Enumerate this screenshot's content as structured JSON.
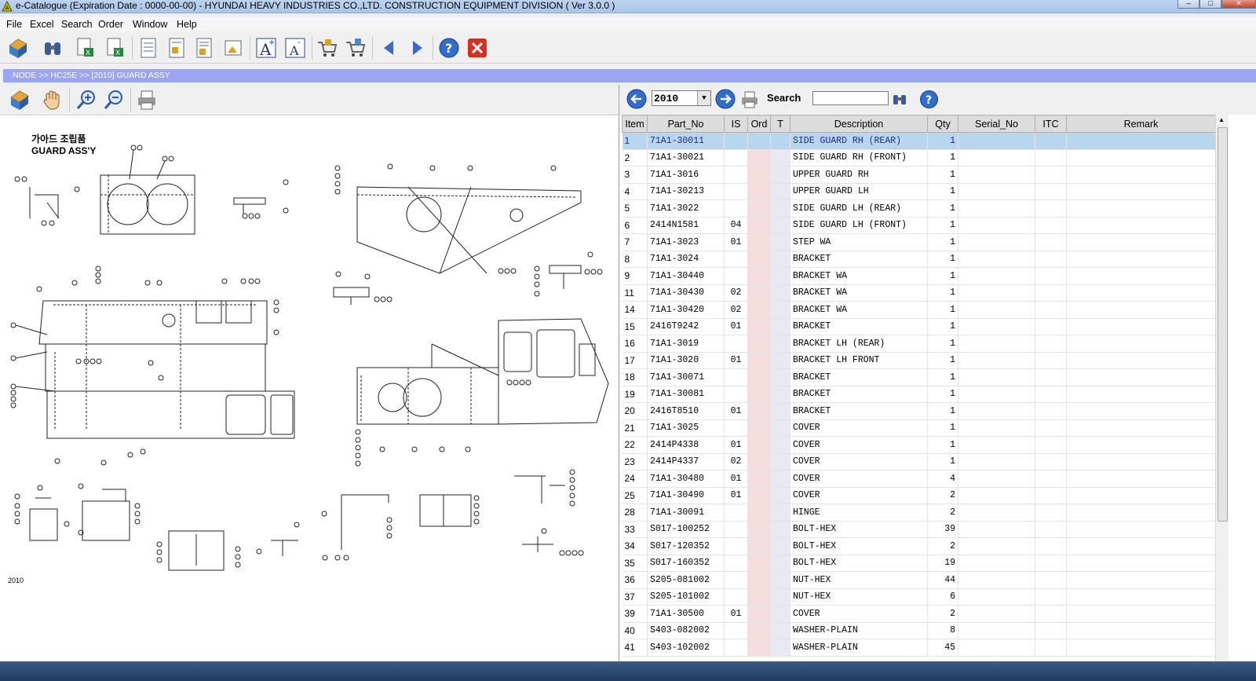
{
  "window": {
    "title": "e-Catalogue (Expiration Date : 0000-00-00)  -  HYUNDAI HEAVY INDUSTRIES CO.,LTD. CONSTRUCTION EQUIPMENT DIVISION ( Ver 3.0.0 )"
  },
  "menu": [
    "File",
    "Excel",
    "Search",
    "Order",
    "Window",
    "Help"
  ],
  "breadcrumb": "NODE >> HC25E >> [2010] GUARD ASSY",
  "drawing": {
    "title_kr": "가아드 조립품",
    "title_en": "GUARD ASS'Y",
    "page_ref": "2010"
  },
  "right_toolbar": {
    "year": "2010",
    "search_label": "Search",
    "search_value": ""
  },
  "table": {
    "columns": [
      "Item",
      "Part_No",
      "IS",
      "Ord",
      "T",
      "Description",
      "Qty",
      "Serial_No",
      "ITC",
      "Remark"
    ],
    "rows": [
      {
        "item": "1",
        "part": "71A1-30011",
        "is": "",
        "desc": "SIDE GUARD RH (REAR)",
        "qty": "1"
      },
      {
        "item": "2",
        "part": "71A1-30021",
        "is": "",
        "desc": "SIDE GUARD RH (FRONT)",
        "qty": "1"
      },
      {
        "item": "3",
        "part": "71A1-3016",
        "is": "",
        "desc": "UPPER GUARD RH",
        "qty": "1"
      },
      {
        "item": "4",
        "part": "71A1-30213",
        "is": "",
        "desc": "UPPER GUARD LH",
        "qty": "1"
      },
      {
        "item": "5",
        "part": "71A1-3022",
        "is": "",
        "desc": "SIDE GUARD LH (REAR)",
        "qty": "1"
      },
      {
        "item": "6",
        "part": "2414N1581",
        "is": "04",
        "desc": "SIDE GUARD LH (FRONT)",
        "qty": "1"
      },
      {
        "item": "7",
        "part": "71A1-3023",
        "is": "01",
        "desc": "STEP WA",
        "qty": "1"
      },
      {
        "item": "8",
        "part": "71A1-3024",
        "is": "",
        "desc": "BRACKET",
        "qty": "1"
      },
      {
        "item": "9",
        "part": "71A1-30440",
        "is": "",
        "desc": "BRACKET WA",
        "qty": "1"
      },
      {
        "item": "11",
        "part": "71A1-30430",
        "is": "02",
        "desc": "BRACKET WA",
        "qty": "1"
      },
      {
        "item": "14",
        "part": "71A1-30420",
        "is": "02",
        "desc": "BRACKET WA",
        "qty": "1"
      },
      {
        "item": "15",
        "part": "2416T9242",
        "is": "01",
        "desc": "BRACKET",
        "qty": "1"
      },
      {
        "item": "16",
        "part": "71A1-3019",
        "is": "",
        "desc": "BRACKET LH (REAR)",
        "qty": "1"
      },
      {
        "item": "17",
        "part": "71A1-3020",
        "is": "01",
        "desc": "BRACKET LH FRONT",
        "qty": "1"
      },
      {
        "item": "18",
        "part": "71A1-30071",
        "is": "",
        "desc": "BRACKET",
        "qty": "1"
      },
      {
        "item": "19",
        "part": "71A1-30081",
        "is": "",
        "desc": "BRACKET",
        "qty": "1"
      },
      {
        "item": "20",
        "part": "2416T8510",
        "is": "01",
        "desc": "BRACKET",
        "qty": "1"
      },
      {
        "item": "21",
        "part": "71A1-3025",
        "is": "",
        "desc": "COVER",
        "qty": "1"
      },
      {
        "item": "22",
        "part": "2414P4338",
        "is": "01",
        "desc": "COVER",
        "qty": "1"
      },
      {
        "item": "23",
        "part": "2414P4337",
        "is": "02",
        "desc": "COVER",
        "qty": "1"
      },
      {
        "item": "24",
        "part": "71A1-30480",
        "is": "01",
        "desc": "COVER",
        "qty": "4"
      },
      {
        "item": "25",
        "part": "71A1-30490",
        "is": "01",
        "desc": "COVER",
        "qty": "2"
      },
      {
        "item": "28",
        "part": "71A1-30091",
        "is": "",
        "desc": "HINGE",
        "qty": "2"
      },
      {
        "item": "33",
        "part": "S017-100252",
        "is": "",
        "desc": "BOLT-HEX",
        "qty": "39"
      },
      {
        "item": "34",
        "part": "S017-120352",
        "is": "",
        "desc": "BOLT-HEX",
        "qty": "2"
      },
      {
        "item": "35",
        "part": "S017-160352",
        "is": "",
        "desc": "BOLT-HEX",
        "qty": "19"
      },
      {
        "item": "36",
        "part": "S205-081002",
        "is": "",
        "desc": "NUT-HEX",
        "qty": "44"
      },
      {
        "item": "37",
        "part": "S205-101002",
        "is": "",
        "desc": "NUT-HEX",
        "qty": "6"
      },
      {
        "item": "39",
        "part": "71A1-30500",
        "is": "01",
        "desc": "COVER",
        "qty": "2"
      },
      {
        "item": "40",
        "part": "S403-082002",
        "is": "",
        "desc": "WASHER-PLAIN",
        "qty": "8"
      },
      {
        "item": "41",
        "part": "S403-102002",
        "is": "",
        "desc": "WASHER-PLAIN",
        "qty": "45"
      }
    ]
  }
}
